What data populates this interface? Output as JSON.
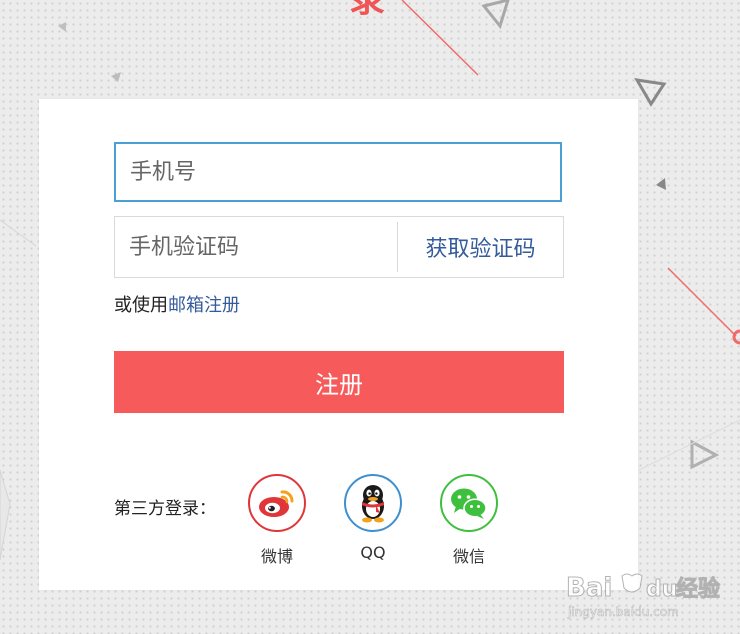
{
  "header": {
    "partial_char": "录"
  },
  "form": {
    "phone_placeholder": "手机号",
    "code_placeholder": "手机验证码",
    "get_code_label": "获取验证码",
    "alt_prefix": "或使用",
    "alt_link": "邮箱注册",
    "register_label": "注册"
  },
  "third_party": {
    "label": "第三方登录：",
    "providers": [
      {
        "name": "微博",
        "icon": "weibo-icon",
        "color": "#e0363a"
      },
      {
        "name": "QQ",
        "icon": "qq-icon",
        "color": "#3f8fcf"
      },
      {
        "name": "微信",
        "icon": "wechat-icon",
        "color": "#3ec03e"
      }
    ]
  },
  "watermark": {
    "brand": "Bai du 经验",
    "domain": "jingyan.baidu.com"
  },
  "colors": {
    "accent": "#f75a5a",
    "link": "#345b9a",
    "focus_border": "#4a9fd6"
  }
}
